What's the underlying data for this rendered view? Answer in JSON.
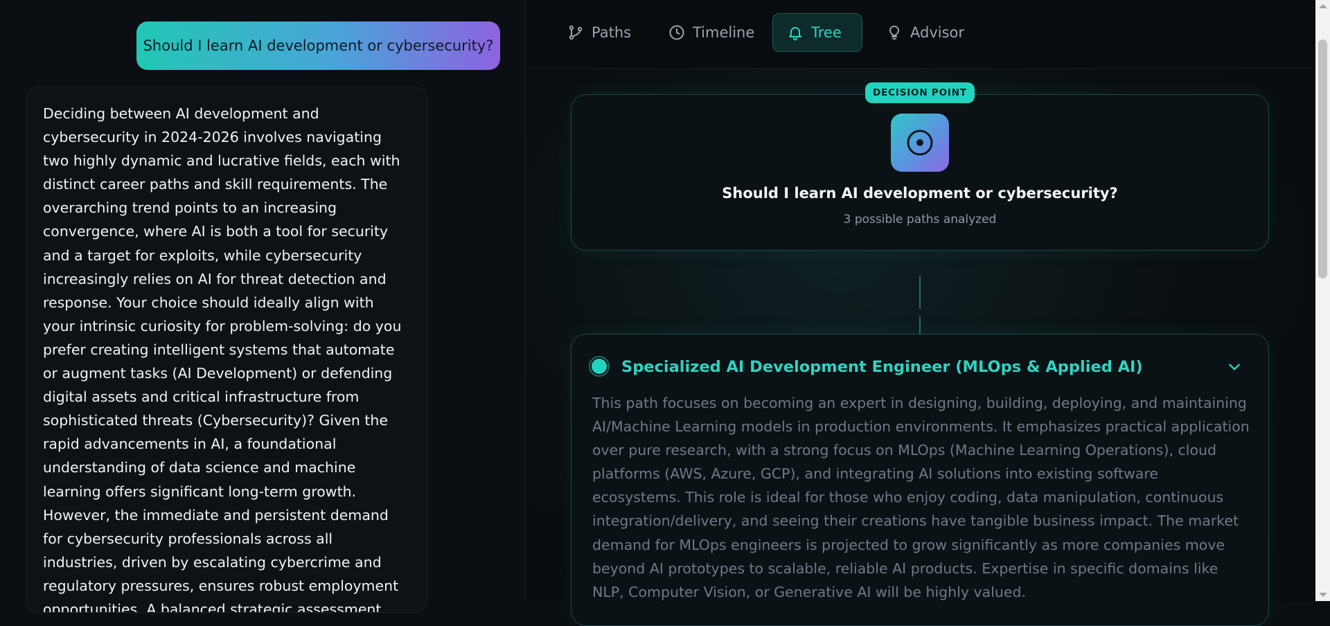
{
  "chat": {
    "user_message": "Should I learn AI development or cybersecurity?",
    "assistant_message": "Deciding between AI development and cybersecurity in 2024-2026 involves navigating two highly dynamic and lucrative fields, each with distinct career paths and skill requirements. The overarching trend points to an increasing convergence, where AI is both a tool for security and a target for exploits, while cybersecurity increasingly relies on AI for threat detection and response. Your choice should ideally align with your intrinsic curiosity for problem-solving: do you prefer creating intelligent systems that automate or augment tasks (AI Development) or defending digital assets and critical infrastructure from sophisticated threats (Cybersecurity)? Given the rapid advancements in AI, a foundational understanding of data science and machine learning offers significant long-term growth. However, the immediate and persistent demand for cybersecurity professionals across all industries, driven by escalating cybercrime and regulatory pressures, ensures robust employment opportunities. A balanced strategic assessment suggests that while"
  },
  "tabs": [
    {
      "label": "Paths",
      "icon": "git-branch-icon"
    },
    {
      "label": "Timeline",
      "icon": "clock-icon"
    },
    {
      "label": "Tree",
      "icon": "bell-icon",
      "active": true
    },
    {
      "label": "Advisor",
      "icon": "lightbulb-icon"
    }
  ],
  "decision": {
    "badge": "DECISION POINT",
    "icon": "target-icon",
    "question": "Should I learn AI development or cybersecurity?",
    "subtitle": "3 possible paths analyzed"
  },
  "paths": [
    {
      "title": "Specialized AI Development Engineer (MLOps & Applied AI)",
      "description": "This path focuses on becoming an expert in designing, building, deploying, and maintaining AI/Machine Learning models in production environments. It emphasizes practical application over pure research, with a strong focus on MLOps (Machine Learning Operations), cloud platforms (AWS, Azure, GCP), and integrating AI solutions into existing software ecosystems. This role is ideal for those who enjoy coding, data manipulation, continuous integration/delivery, and seeing their creations have tangible business impact. The market demand for MLOps engineers is projected to grow significantly as more companies move beyond AI prototypes to scalable, reliable AI products. Expertise in specific domains like NLP, Computer Vision, or Generative AI will be highly valued."
    }
  ],
  "colors": {
    "accent": "#22d3bf",
    "background": "#090c0f",
    "bubble_gradient_start": "#21c8b4",
    "bubble_gradient_end": "#8d63e0"
  }
}
